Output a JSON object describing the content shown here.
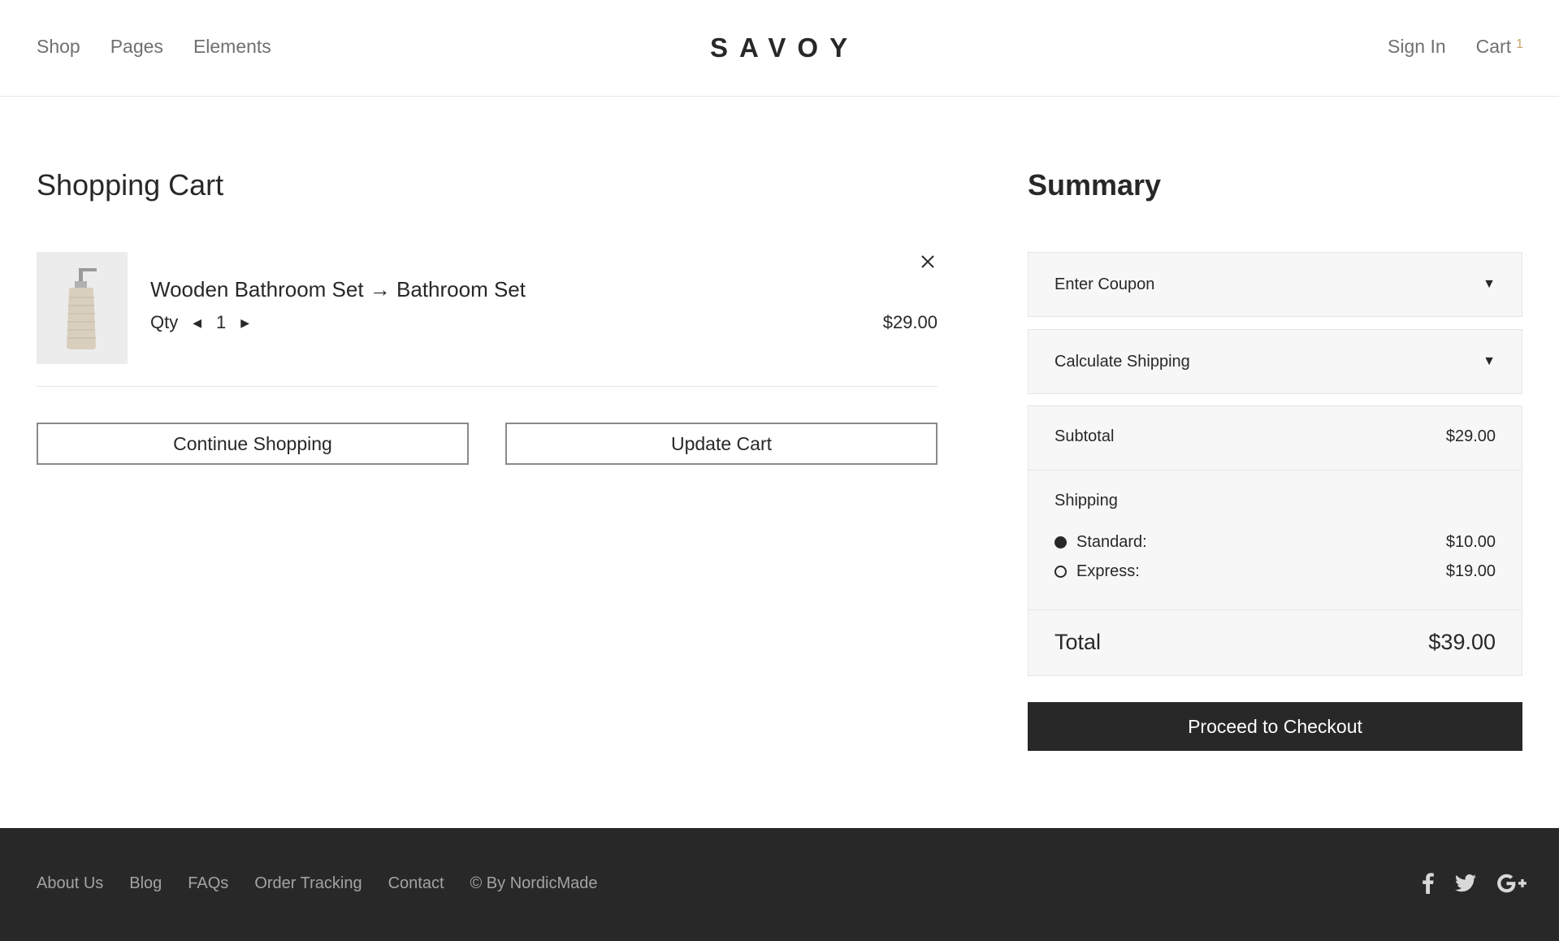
{
  "header": {
    "nav_left": [
      "Shop",
      "Pages",
      "Elements"
    ],
    "logo": "SAVOY",
    "sign_in": "Sign In",
    "cart_label": "Cart",
    "cart_count": "1"
  },
  "cart": {
    "title": "Shopping Cart",
    "item": {
      "name": "Wooden Bathroom Set → Bathroom Set",
      "qty_label": "Qty",
      "qty": "1",
      "price": "$29.00"
    },
    "continue_label": "Continue Shopping",
    "update_label": "Update Cart"
  },
  "summary": {
    "title": "Summary",
    "coupon_label": "Enter Coupon",
    "shipping_calc_label": "Calculate Shipping",
    "subtotal_label": "Subtotal",
    "subtotal_value": "$29.00",
    "shipping_label": "Shipping",
    "options": [
      {
        "label": "Standard:",
        "price": "$10.00",
        "selected": true
      },
      {
        "label": "Express:",
        "price": "$19.00",
        "selected": false
      }
    ],
    "total_label": "Total",
    "total_value": "$39.00",
    "checkout_label": "Proceed to Checkout"
  },
  "footer": {
    "links": [
      "About Us",
      "Blog",
      "FAQs",
      "Order Tracking",
      "Contact"
    ],
    "copyright": "© By NordicMade",
    "social_icons": [
      "facebook-icon",
      "twitter-icon",
      "google-plus-icon"
    ]
  },
  "colors": {
    "accent": "#c7a56c",
    "dark": "#282828",
    "muted": "#707070"
  }
}
